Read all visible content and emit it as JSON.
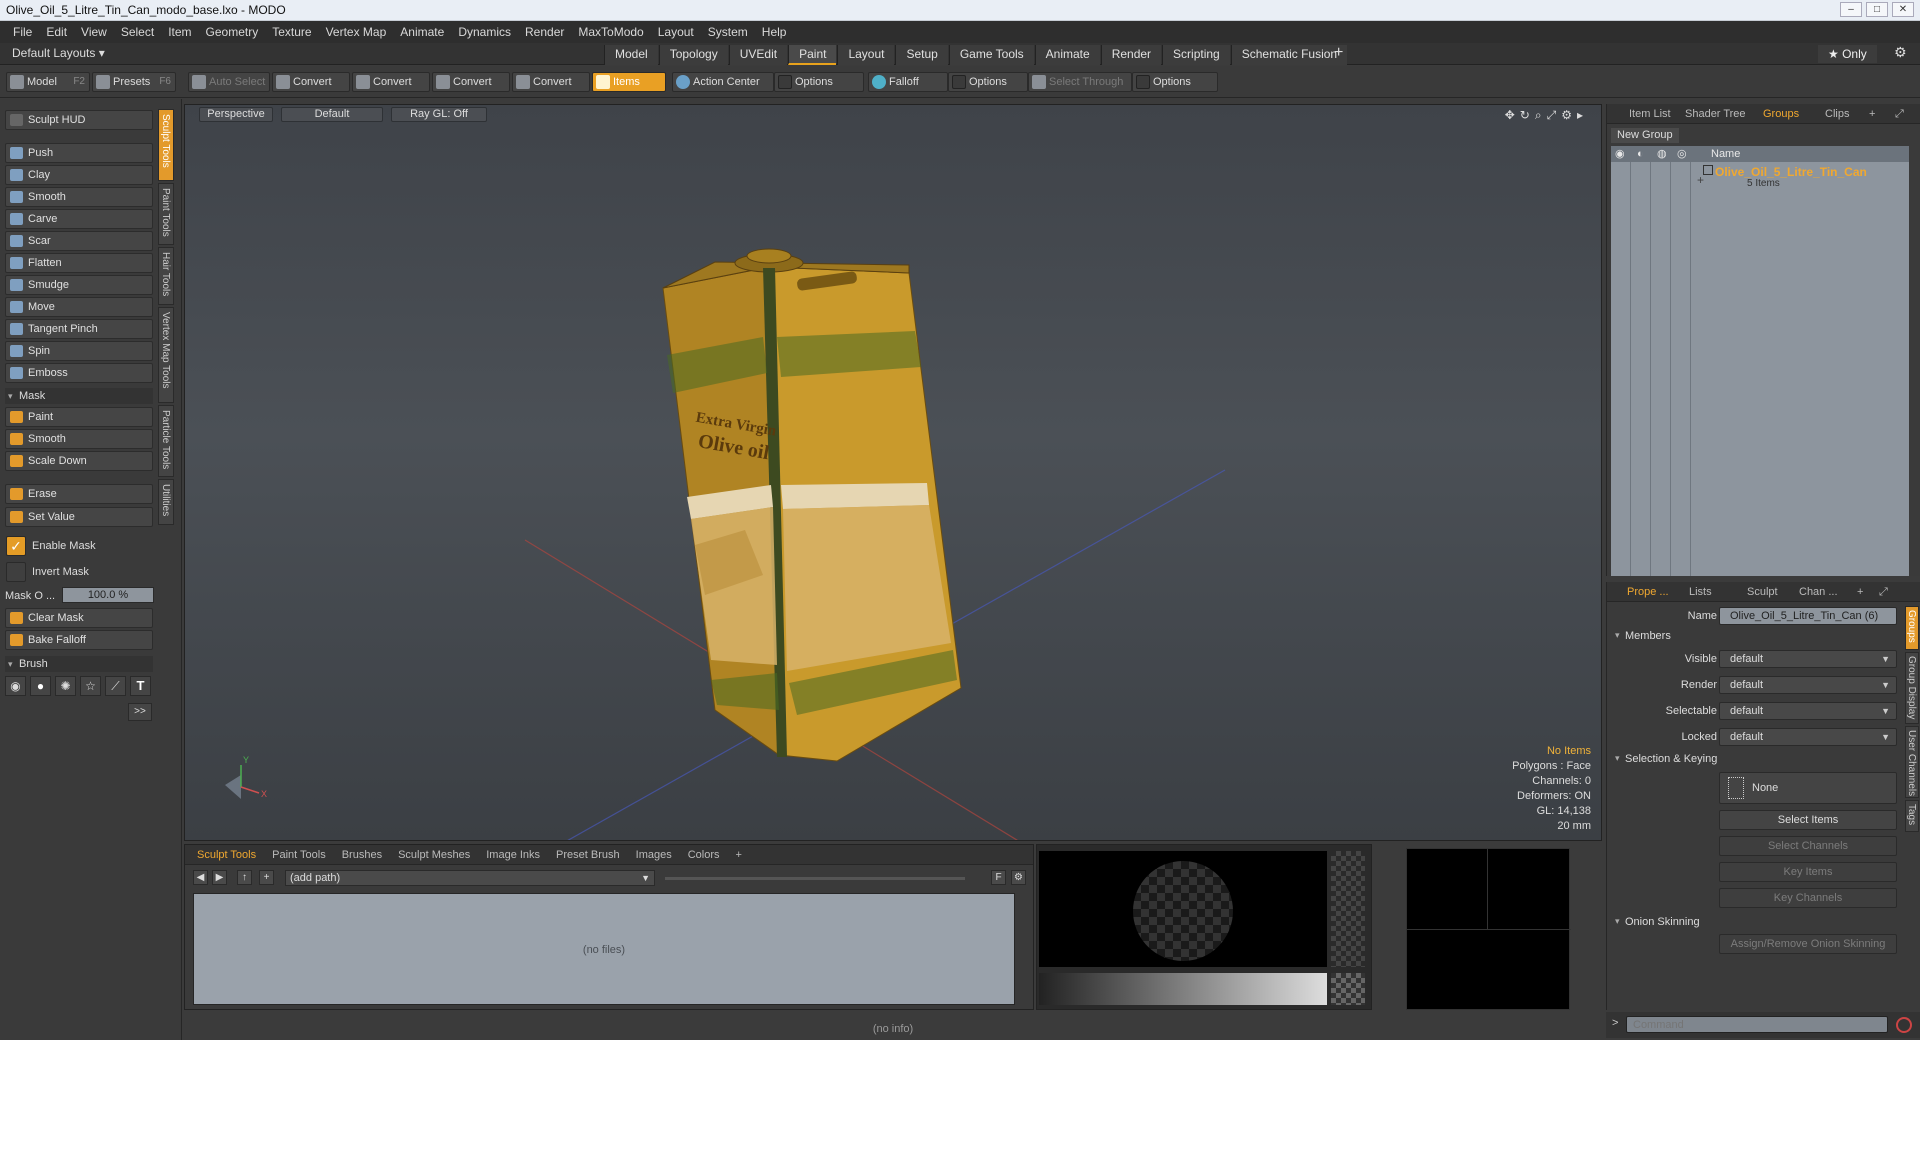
{
  "window": {
    "title": "Olive_Oil_5_Litre_Tin_Can_modo_base.lxo - MODO"
  },
  "menu": [
    "File",
    "Edit",
    "View",
    "Select",
    "Item",
    "Geometry",
    "Texture",
    "Vertex Map",
    "Animate",
    "Dynamics",
    "Render",
    "MaxToModo",
    "Layout",
    "System",
    "Help"
  ],
  "layouts": {
    "label": "Default Layouts ▾",
    "tabs": [
      "Model",
      "Topology",
      "UVEdit",
      "Paint",
      "Layout",
      "Setup",
      "Game Tools",
      "Animate",
      "Render",
      "Scripting",
      "Schematic Fusion"
    ],
    "active": "Paint",
    "only": "★  Only"
  },
  "toolbar": {
    "model": "Model",
    "model_key": "F2",
    "presets": "Presets",
    "presets_key": "F6",
    "auto_select": "Auto Select",
    "convert1": "Convert",
    "convert2": "Convert",
    "convert3": "Convert",
    "convert4": "Convert",
    "items": "Items",
    "action_center": "Action Center",
    "options1": "Options",
    "falloff": "Falloff",
    "options2": "Options",
    "select_through": "Select Through",
    "options3": "Options"
  },
  "left": {
    "hud": "Sculpt HUD",
    "tools": [
      "Push",
      "Clay",
      "Smooth",
      "Carve",
      "Scar",
      "Flatten",
      "Smudge",
      "Move",
      "Tangent Pinch",
      "Spin",
      "Emboss"
    ],
    "mask_section": "Mask",
    "mask_tools": [
      "Paint",
      "Smooth",
      "Scale Down"
    ],
    "erase": "Erase",
    "set_value": "Set Value",
    "enable_mask": "Enable Mask",
    "invert_mask": "Invert Mask",
    "mask_opacity_label": "Mask O ...",
    "mask_opacity": "100.0 %",
    "clear_mask": "Clear Mask",
    "bake_falloff": "Bake Falloff",
    "brush_section": "Brush",
    "more": ">>",
    "vtabs": [
      "Sculpt Tools",
      "Paint Tools",
      "Hair Tools",
      "Vertex Map Tools",
      "Particle Tools",
      "Utilities"
    ]
  },
  "viewport": {
    "perspective": "Perspective",
    "default": "Default",
    "raygl": "Ray GL: Off",
    "label_line1": "Extra Virgin",
    "label_line2": "Olive oil",
    "stats": {
      "items": "No Items",
      "polygons": "Polygons : Face",
      "channels": "Channels: 0",
      "deformers": "Deformers: ON",
      "gl": "GL: 14,138",
      "size": "20 mm"
    }
  },
  "browser": {
    "tabs": [
      "Sculpt Tools",
      "Paint Tools",
      "Brushes",
      "Sculpt Meshes",
      "Image Inks",
      "Preset Brush",
      "Images",
      "Colors"
    ],
    "path": "(add path)",
    "f_btn": "F",
    "nofiles": "(no files)"
  },
  "status": "(no info)",
  "right_top": {
    "tabs": [
      "Item List",
      "Shader Tree",
      "Groups",
      "Clips"
    ],
    "active": "Groups",
    "new_group": "New Group",
    "name_col": "Name",
    "group_name": "Olive_Oil_5_Litre_Tin_Can",
    "group_items": "5 Items"
  },
  "props": {
    "tabs": [
      "Prope ...",
      "Lists",
      "Sculpt",
      "Chan ..."
    ],
    "name_label": "Name",
    "name_value": "Olive_Oil_5_Litre_Tin_Can (6)",
    "members": "Members",
    "rows": [
      {
        "label": "Visible",
        "value": "default"
      },
      {
        "label": "Render",
        "value": "default"
      },
      {
        "label": "Selectable",
        "value": "default"
      },
      {
        "label": "Locked",
        "value": "default"
      }
    ],
    "sel_keying": "Selection & Keying",
    "none": "None",
    "select_items": "Select Items",
    "select_channels": "Select Channels",
    "key_items": "Key Items",
    "key_channels": "Key Channels",
    "onion": "Onion Skinning",
    "onion_btn": "Assign/Remove Onion Skinning",
    "vtabs": [
      "Groups",
      "Group Display",
      "User Channels",
      "Tags"
    ]
  },
  "command": {
    "placeholder": "Command",
    "prompt": ">"
  },
  "colors": {
    "accent": "#e8a21c",
    "tin": "#c99a2c",
    "group_name": "#f0a830"
  }
}
